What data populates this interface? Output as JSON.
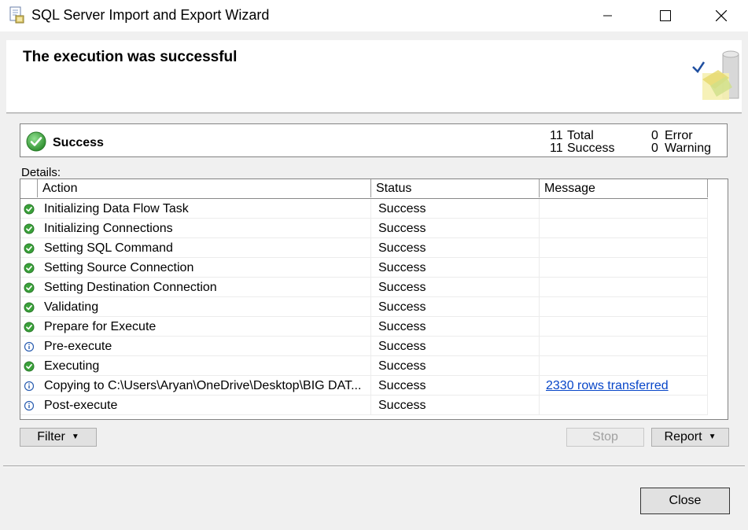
{
  "window": {
    "title": "SQL Server Import and Export Wizard"
  },
  "header": {
    "title": "The execution was successful"
  },
  "summary": {
    "status": "Success",
    "total_count": "11",
    "total_label": "Total",
    "success_count": "11",
    "success_label": "Success",
    "error_count": "0",
    "error_label": "Error",
    "warning_count": "0",
    "warning_label": "Warning"
  },
  "details": {
    "label": "Details:",
    "columns": {
      "action": "Action",
      "status": "Status",
      "message": "Message"
    },
    "rows": [
      {
        "icon": "success-icon",
        "action": "Initializing Data Flow Task",
        "status": "Success",
        "message": ""
      },
      {
        "icon": "success-icon",
        "action": "Initializing Connections",
        "status": "Success",
        "message": ""
      },
      {
        "icon": "success-icon",
        "action": "Setting SQL Command",
        "status": "Success",
        "message": ""
      },
      {
        "icon": "success-icon",
        "action": "Setting Source Connection",
        "status": "Success",
        "message": ""
      },
      {
        "icon": "success-icon",
        "action": "Setting Destination Connection",
        "status": "Success",
        "message": ""
      },
      {
        "icon": "success-icon",
        "action": "Validating",
        "status": "Success",
        "message": ""
      },
      {
        "icon": "success-icon",
        "action": "Prepare for Execute",
        "status": "Success",
        "message": ""
      },
      {
        "icon": "info-icon",
        "action": "Pre-execute",
        "status": "Success",
        "message": ""
      },
      {
        "icon": "success-icon",
        "action": "Executing",
        "status": "Success",
        "message": ""
      },
      {
        "icon": "info-icon",
        "action": "Copying to C:\\Users\\Aryan\\OneDrive\\Desktop\\BIG DAT...",
        "status": "Success",
        "message": "2330 rows transferred"
      },
      {
        "icon": "info-icon",
        "action": "Post-execute",
        "status": "Success",
        "message": ""
      }
    ]
  },
  "buttons": {
    "filter": "Filter",
    "stop": "Stop",
    "report": "Report",
    "close": "Close"
  },
  "colors": {
    "success_green": "#3aa13a",
    "info_blue": "#2a5db0",
    "link_blue": "#0645c8"
  }
}
